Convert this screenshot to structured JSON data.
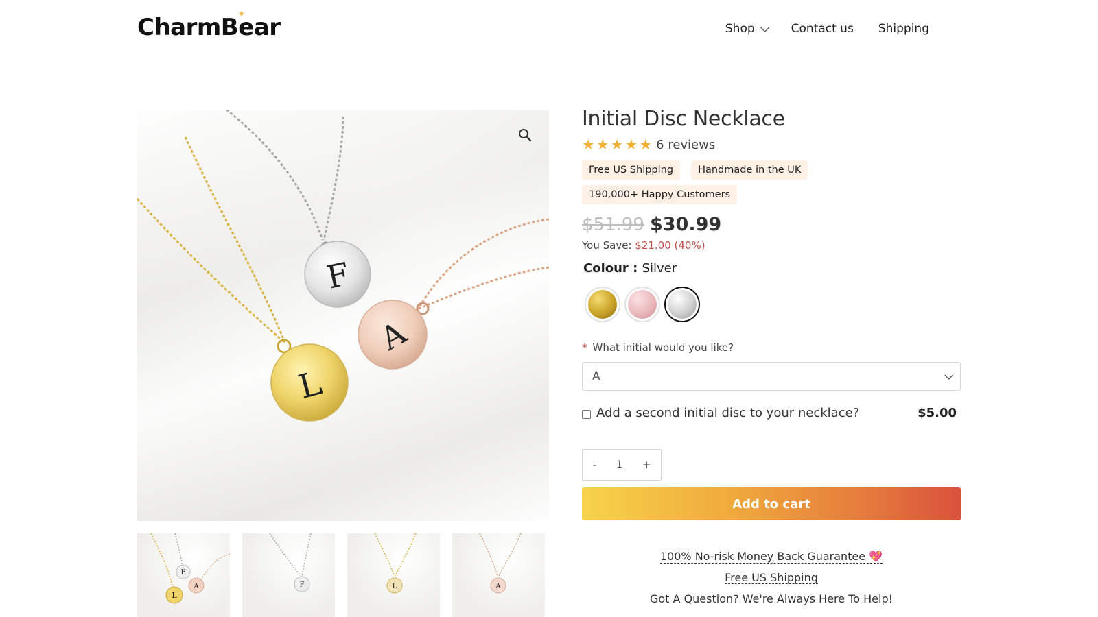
{
  "header": {
    "logo_text": "CharmBear",
    "nav": [
      {
        "label": "Shop"
      },
      {
        "label": "Contact us"
      },
      {
        "label": "Shipping"
      }
    ]
  },
  "product": {
    "title": "Initial Disc Necklace",
    "rating_stars": 5,
    "reviews_label": "6 reviews",
    "badges": [
      "Free US Shipping",
      "Handmade in the UK",
      "190,000+ Happy Customers"
    ],
    "old_price": "$51.99",
    "new_price": "$30.99",
    "save_label": "You Save:",
    "save_amount": "$21.00 (40%)",
    "colour_label": "Colour : ",
    "colour_value": "Silver",
    "swatches": [
      {
        "name": "Gold",
        "color": "#c9a227"
      },
      {
        "name": "Rose Gold",
        "color": "#e8b4b8"
      },
      {
        "name": "Silver",
        "color": "#c8c8c8",
        "selected": true
      }
    ],
    "initial_question": "What initial would you like?",
    "initial_required_mark": "*",
    "initial_value": "A",
    "addon_label": "Add a second initial disc to your necklace?",
    "addon_price": "$5.00",
    "qty_minus": "-",
    "qty_value": "1",
    "qty_plus": "+",
    "add_to_cart": "Add to cart",
    "guarantee_1": "100% No-risk Money Back Guarantee",
    "guarantee_1_icon": "💖",
    "guarantee_2": "Free US Shipping",
    "guarantee_3": "Got A Question? We're Always Here To Help!"
  },
  "gallery": {
    "disc_letters": [
      "F",
      "A",
      "L"
    ],
    "thumb_letters": [
      [
        "F",
        "A",
        "L"
      ],
      [
        "F"
      ],
      [
        "L"
      ],
      [
        "A"
      ]
    ]
  },
  "colors": {
    "accent_red": "#c0504d",
    "star": "#f2b136",
    "badge_bg": "#fdf1e6"
  }
}
